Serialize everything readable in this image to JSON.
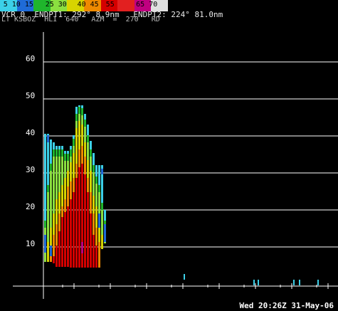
{
  "colorbar": {
    "labels": [
      "5 10 15",
      "25 30",
      "40 45",
      "55",
      "65 70"
    ],
    "segments": [
      {
        "color": "#3cd0e8",
        "label_index": 0
      },
      {
        "color": "#1f6bd8",
        "label_index": 0
      },
      {
        "color": "#1fb52c",
        "label_index": 1
      },
      {
        "color": "#8be040",
        "label_index": 1
      },
      {
        "color": "#d7d400",
        "label_index": 2
      },
      {
        "color": "#ef8a00",
        "label_index": 2
      },
      {
        "color": "#d50000",
        "label_index": 3
      },
      {
        "color": "#e22020",
        "label_index": 3
      },
      {
        "color": "#c00080",
        "label_index": 4
      },
      {
        "color": "#e0e0e0",
        "label_index": 4
      }
    ]
  },
  "header": {
    "line1": "VCR 0  ENDPT1: 292° 8.9nm   ENDPT2: 224° 81.0nm",
    "line2": "LT KSBOZ  HLI  640   AZM  =  270   RD"
  },
  "axis": {
    "y_labels": [
      "10",
      "20",
      "30",
      "40",
      "50",
      "60"
    ]
  },
  "footer": {
    "timestamp": "Wed 20:26Z 31-May-06"
  },
  "colors": {
    "grid": "#ffffff",
    "background": "#000000"
  }
}
